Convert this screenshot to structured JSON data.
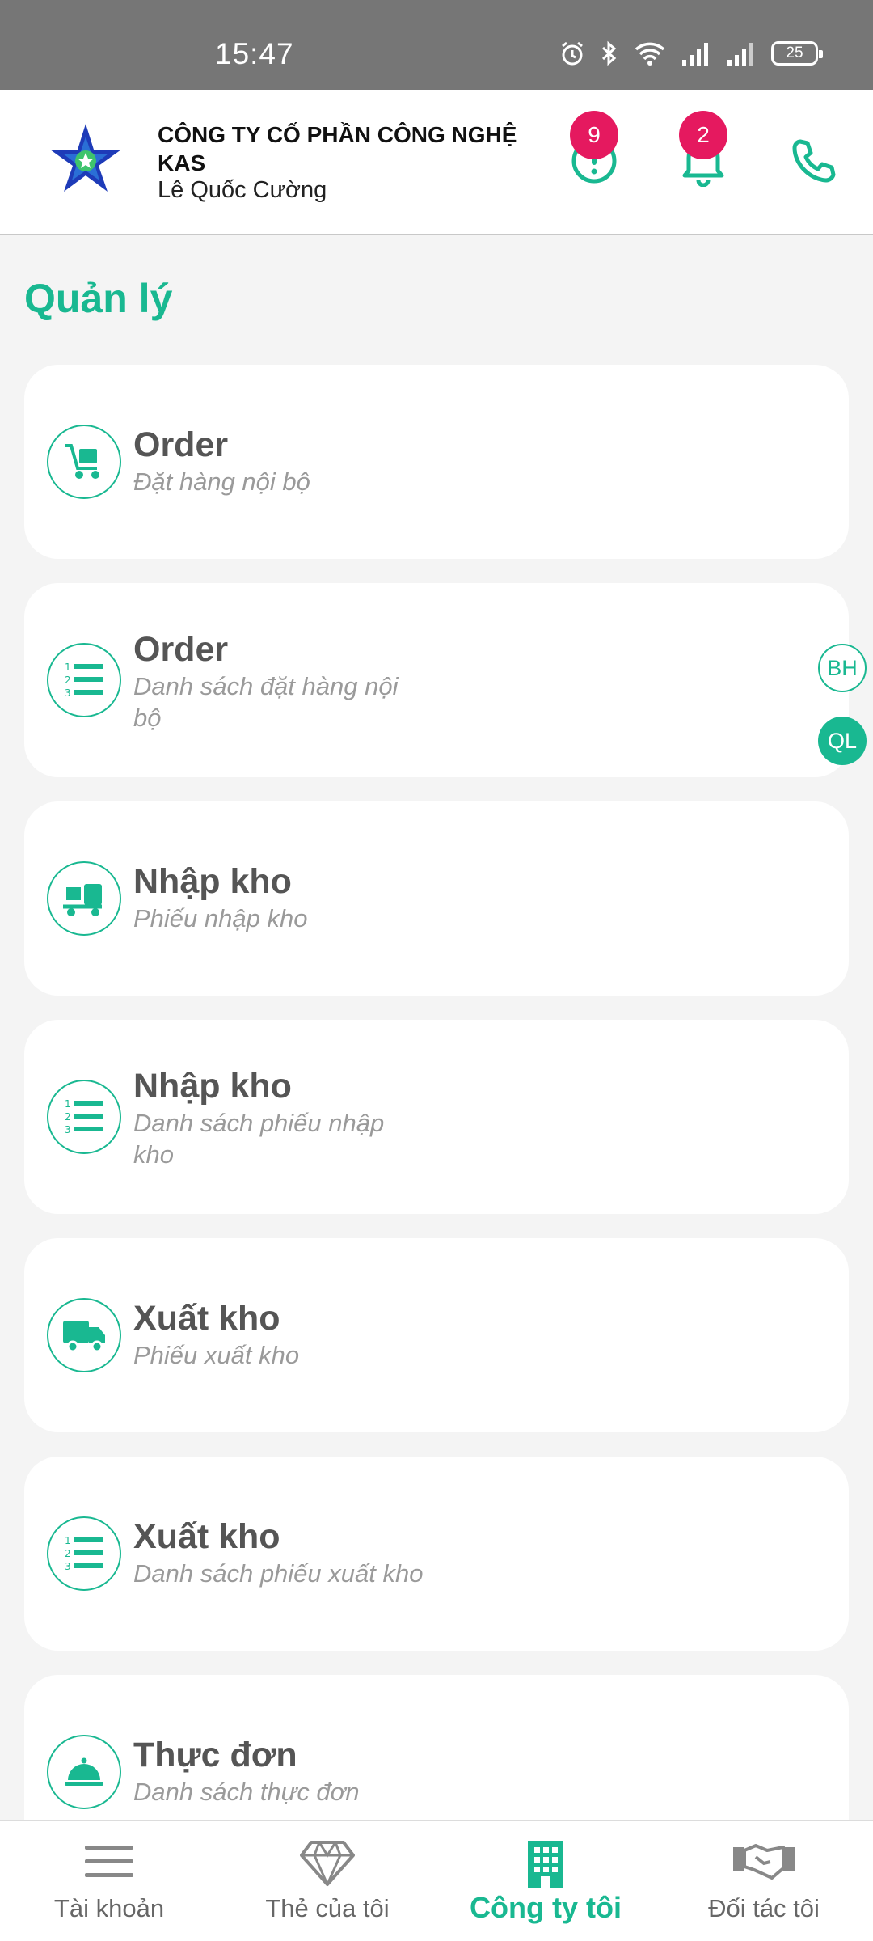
{
  "status_bar": {
    "time": "15:47",
    "battery": "25"
  },
  "header": {
    "company_name": "CÔNG TY CỐ PHẦN CÔNG NGHỆ KAS",
    "user_name": "Lê Quốc Cường",
    "alerts_count": "9",
    "notifications_count": "2"
  },
  "section_title": "Quản lý",
  "cards": [
    {
      "title": "Order",
      "subtitle": "Đặt hàng nội bộ",
      "icon": "cart-icon"
    },
    {
      "title": "Order",
      "subtitle": "Danh sách đặt hàng nội bộ",
      "icon": "numbered-list-icon"
    },
    {
      "title": "Nhập kho",
      "subtitle": "Phiếu nhập kho",
      "icon": "forklift-icon"
    },
    {
      "title": "Nhập kho",
      "subtitle": "Danh sách phiếu nhập kho",
      "icon": "numbered-list-icon"
    },
    {
      "title": "Xuất kho",
      "subtitle": "Phiếu xuất kho",
      "icon": "truck-icon"
    },
    {
      "title": "Xuất kho",
      "subtitle": "Danh sách phiếu xuất kho",
      "icon": "numbered-list-icon"
    },
    {
      "title": "Thực đơn",
      "subtitle": "Danh sách thực đơn",
      "icon": "food-cloche-icon"
    }
  ],
  "chips": {
    "bh": "BH",
    "ql": "QL"
  },
  "bottom_nav": [
    {
      "label": "Tài khoản",
      "icon": "menu-icon"
    },
    {
      "label": "Thẻ của tôi",
      "icon": "diamond-icon"
    },
    {
      "label": "Công ty tôi",
      "icon": "building-icon",
      "active": true
    },
    {
      "label": "Đối tác tôi",
      "icon": "handshake-icon"
    }
  ],
  "colors": {
    "accent": "#19b891",
    "badge": "#e5195f",
    "status_bar": "#767676"
  }
}
